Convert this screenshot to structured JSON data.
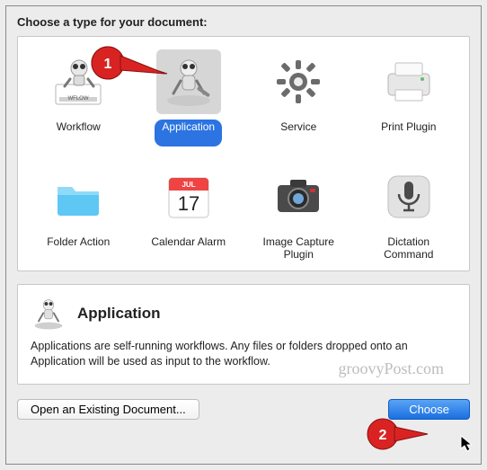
{
  "heading": "Choose a type for your document:",
  "types": {
    "workflow": "Workflow",
    "application": "Application",
    "service": "Service",
    "print_plugin": "Print Plugin",
    "folder_action": "Folder Action",
    "calendar_alarm": "Calendar Alarm",
    "image_capture_plugin": "Image Capture Plugin",
    "dictation_command": "Dictation Command"
  },
  "selected_type": "application",
  "description": {
    "title": "Application",
    "body": "Applications are self-running workflows. Any files or folders dropped onto an Application will be used as input to the workflow."
  },
  "buttons": {
    "open_existing": "Open an Existing Document...",
    "choose": "Choose"
  },
  "watermark": "groovyPost.com",
  "callouts": {
    "c1": "1",
    "c2": "2"
  },
  "icons": {
    "wflow_tab": "WFLOW",
    "calendar_month": "JUL",
    "calendar_day": "17"
  }
}
